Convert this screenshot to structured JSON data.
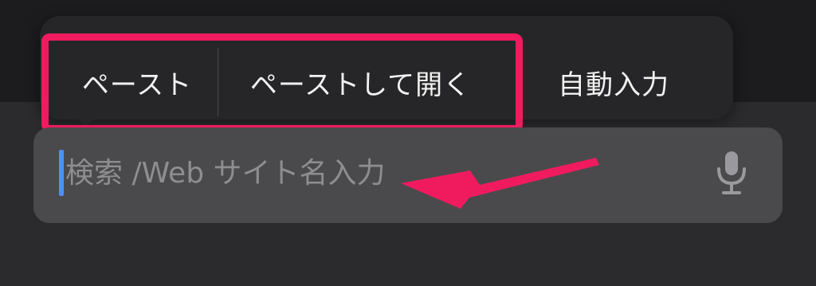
{
  "context_menu": {
    "items": [
      {
        "label": "ペースト"
      },
      {
        "label": "ペーストして開く"
      },
      {
        "label": "自動入力"
      }
    ]
  },
  "search": {
    "placeholder": "検索 /Web サイト名入力"
  },
  "icons": {
    "mic": "microphone-icon"
  },
  "colors": {
    "highlight": "#f01b5f",
    "caret": "#4f8ff7"
  }
}
